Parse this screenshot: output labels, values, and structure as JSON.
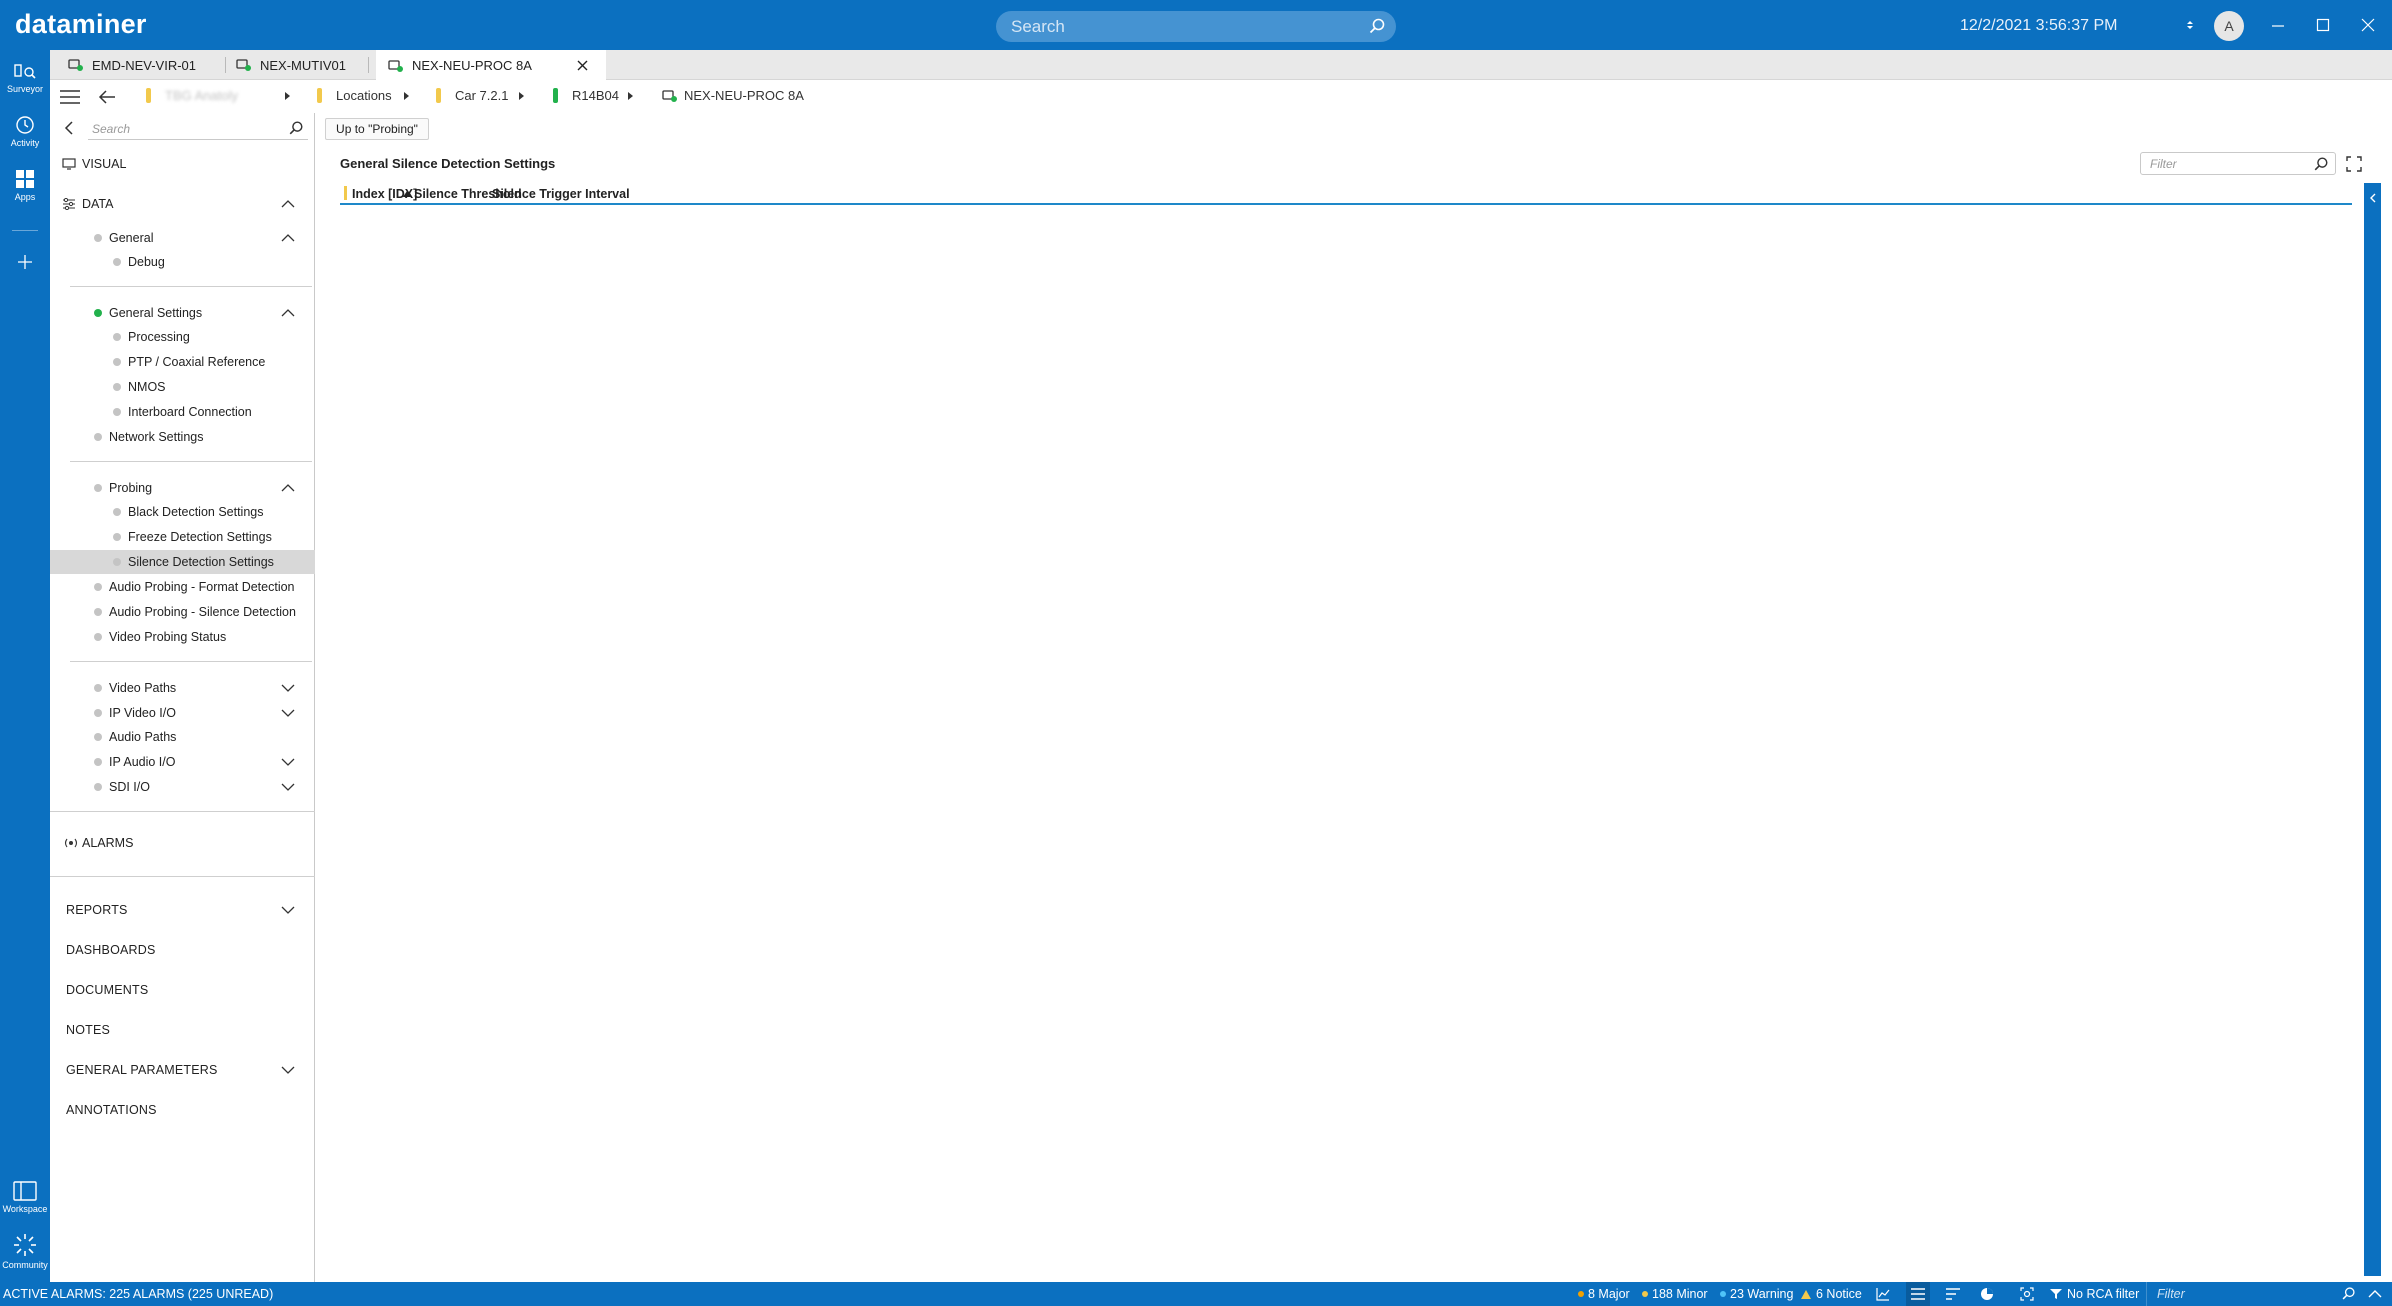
{
  "app": {
    "logo": "dataminer",
    "search_placeholder": "Search",
    "clock": "12/2/2021 3:56:37 PM",
    "user_initial": "A"
  },
  "leftnav": {
    "surveyor": "Surveyor",
    "activity": "Activity",
    "apps": "Apps",
    "workspace": "Workspace",
    "community": "Community"
  },
  "tabs": [
    {
      "label": "EMD-NEV-VIR-01"
    },
    {
      "label": "NEX-MUTIV01"
    },
    {
      "label": "NEX-NEU-PROC 8A"
    }
  ],
  "breadcrumb": {
    "hidden_item": "TBG Anatoly",
    "locations": "Locations",
    "car": "Car 7.2.1",
    "rack": "R14B04",
    "element": "NEX-NEU-PROC 8A"
  },
  "tree": {
    "search_placeholder": "Search",
    "visual": "VISUAL",
    "data": "DATA",
    "general": "General",
    "debug": "Debug",
    "general_settings": "General Settings",
    "processing": "Processing",
    "ptp": "PTP / Coaxial Reference",
    "nmos": "NMOS",
    "interboard": "Interboard Connection",
    "network_settings": "Network Settings",
    "probing": "Probing",
    "black_detection": "Black Detection Settings",
    "freeze_detection": "Freeze Detection Settings",
    "silence_detection": "Silence Detection Settings",
    "audio_format": "Audio Probing - Format Detection",
    "audio_silence": "Audio Probing - Silence Detection",
    "video_probing_status": "Video Probing Status",
    "video_paths": "Video Paths",
    "ip_video_io": "IP Video I/O",
    "audio_paths": "Audio Paths",
    "ip_audio_io": "IP Audio I/O",
    "sdi_io": "SDI I/O",
    "alarms": "ALARMS",
    "reports": "REPORTS",
    "dashboards": "DASHBOARDS",
    "documents": "DOCUMENTS",
    "notes": "NOTES",
    "general_parameters": "GENERAL PARAMETERS",
    "annotations": "ANNOTATIONS"
  },
  "content": {
    "up_button": "Up to \"Probing\"",
    "title": "General Silence Detection Settings",
    "filter_placeholder": "Filter",
    "columns": [
      "Index [IDX]",
      "Silence Threshold",
      "Silence Trigger Interval"
    ]
  },
  "statusbar": {
    "active_alarms": "ACTIVE ALARMS: 225 ALARMS (225 UNREAD)",
    "major": "8 Major",
    "minor": "188 Minor",
    "warning": "23 Warning",
    "notice": "6 Notice",
    "rca": "No RCA filter",
    "filter_placeholder": "Filter"
  },
  "colors": {
    "brand": "#0b70c0",
    "accent": "#1e88c9",
    "ok": "#22b14c",
    "warning": "#f2c94c",
    "major": "#f2a100"
  }
}
